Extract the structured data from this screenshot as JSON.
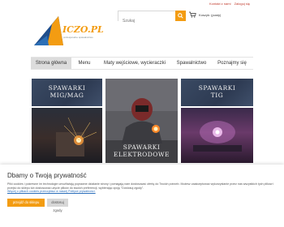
{
  "top_links": {
    "contact": "Kontakt z nami",
    "login": "Zaloguj się"
  },
  "logo": {
    "text": "ICZO.PL",
    "tagline": "profesjonalne spawalnictwo"
  },
  "search": {
    "placeholder": "Szukaj"
  },
  "cart": {
    "label": "Koszyk: (pusty)"
  },
  "nav": {
    "items": [
      {
        "label": "Strona główna",
        "active": true
      },
      {
        "label": "Menu",
        "active": false
      },
      {
        "label": "Maty wejściowe, wycieraczki",
        "active": false
      },
      {
        "label": "Spawalnictwo",
        "active": false
      },
      {
        "label": "Poznajmy się",
        "active": false
      }
    ]
  },
  "tiles": {
    "mig_mag": {
      "line1": "SPAWARKI",
      "line2": "MIG/MAG"
    },
    "tig": {
      "line1": "SPAWARKI",
      "line2": "TIG"
    },
    "electrode": {
      "line1": "SPAWARKI",
      "line2": "ELEKTRODOWE"
    }
  },
  "cookie": {
    "title": "Dbamy o Twoją prywatność",
    "text": "Pliki cookies i pokrewne im technologie umożliwiają poprawne działanie strony i pomagają nam dostosować ofertę do Twoich potrzeb. Możesz zaakceptować wykorzystanie przez nas wszystkich tych plików i przejść do sklepu lub dostosować użycie plików do swoich preferencji, wybierając opcję \"Dostosuj zgody\".",
    "link": "Więcej o plikach cookies przeczytasz w naszej Polityce prywatności.",
    "accept_label": "przejdź do sklepu",
    "customize_label": "dostosuj zgody"
  },
  "colors": {
    "accent": "#f39c12",
    "logo_blue": "#1f4e8c"
  }
}
